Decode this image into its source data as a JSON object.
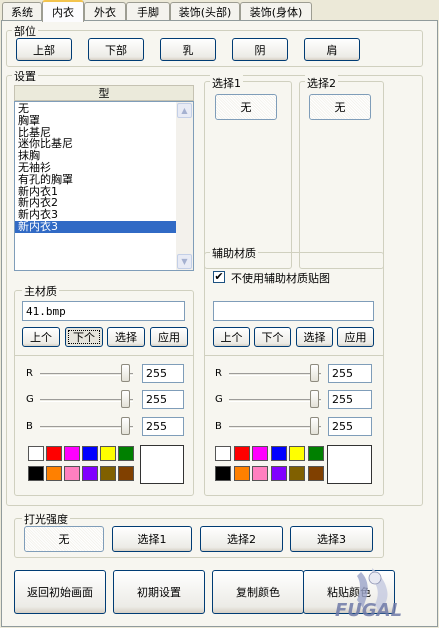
{
  "tabs": [
    "系统",
    "内衣",
    "外衣",
    "手脚",
    "装饰(头部)",
    "装饰(身体)"
  ],
  "part": {
    "legend": "部位",
    "buttons": [
      "上部",
      "下部",
      "乳",
      "阴",
      "肩"
    ]
  },
  "settings": {
    "legend": "设置",
    "type_header": "型",
    "type_items": [
      "无",
      "胸罩",
      "比基尼",
      "迷你比基尼",
      "抹胸",
      "无袖衫",
      "有孔的胸罩",
      "新内衣1",
      "新内衣2",
      "新内衣3",
      "新内衣3"
    ],
    "selected_index": 10,
    "select1": {
      "legend": "选择1",
      "value": "无"
    },
    "select2": {
      "legend": "选择2",
      "value": "无"
    }
  },
  "main_material": {
    "legend": "主材质",
    "file": "41.bmp",
    "buttons": [
      "上个",
      "下个",
      "选择",
      "应用"
    ],
    "r_label": "R",
    "g_label": "G",
    "b_label": "B",
    "r": "255",
    "g": "255",
    "b": "255"
  },
  "aux_material": {
    "legend": "辅助材质",
    "checkbox_label": "不使用辅助材质贴图",
    "checked": true,
    "file": "",
    "buttons": [
      "上个",
      "下个",
      "选择",
      "应用"
    ],
    "r_label": "R",
    "g_label": "G",
    "b_label": "B",
    "r": "255",
    "g": "255",
    "b": "255"
  },
  "palette": {
    "row1": [
      "#ffffff",
      "#ff0000",
      "#ff00ff",
      "#0000ff",
      "#ffff00",
      "#008000"
    ],
    "row2": [
      "#000000",
      "#ff8000",
      "#ff80c0",
      "#8000ff",
      "#806000",
      "#804000"
    ],
    "preview": "#ffffff"
  },
  "lighting": {
    "legend": "打光强度",
    "buttons": [
      "无",
      "选择1",
      "选择2",
      "选择3"
    ]
  },
  "bottom_buttons": [
    "返回初始画面",
    "初期设置",
    "复制颜色",
    "粘贴颜色"
  ],
  "watermark_text": "FUGAL"
}
